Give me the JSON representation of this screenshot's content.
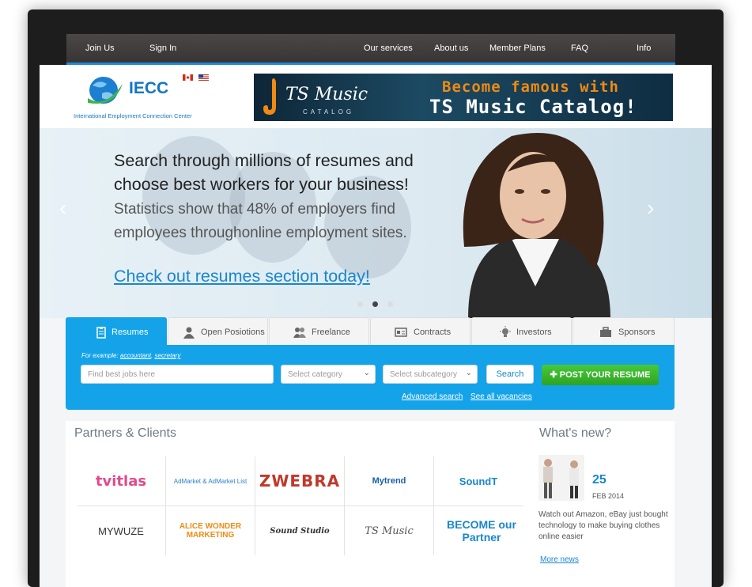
{
  "nav": {
    "join": "Join Us",
    "signin": "Sign In",
    "services": "Our services",
    "about": "About us",
    "plans": "Member Plans",
    "faq": "FAQ",
    "info": "Info"
  },
  "logo": {
    "name": "IECC",
    "subtitle": "International Employment Connection Center"
  },
  "banner": {
    "line1": "Become famous with",
    "line2": "TS Music Catalog!",
    "brand": "TS Music",
    "brand_sub": "CATALOG"
  },
  "hero": {
    "headline_a": "Search through millions of resumes and choose best workers for your business!",
    "headline_b": " Statistics show that 48% of employers find employees throughonline employment sites.",
    "link": "Check out resumes section today!"
  },
  "tabs": [
    "Resumes",
    "Open Posiotions",
    "Freelance",
    "Contracts",
    "Investors",
    "Sponsors"
  ],
  "search": {
    "example_prefix": "For example: ",
    "example_1": "accountant",
    "example_sep": ", ",
    "example_2": "secretary",
    "placeholder": "Find best jobs here",
    "category": "Select category",
    "subcategory": "Select subcategory",
    "search_btn": "Search",
    "post_btn": "POST YOUR RESUME",
    "advanced": "Advanced search",
    "all_vacancies": "See all vacancies"
  },
  "partners": {
    "title": "Partners & Clients",
    "logos": [
      "tvitlas",
      "AdMarket & AdMarket List",
      "ZWEBRA",
      "Mytrend",
      "SoundT",
      "MYWUZE",
      "ALICE WONDER MARKETING",
      "Sound Studio",
      "TS Music",
      "BECOME our Partner"
    ]
  },
  "news": {
    "title": "What's new?",
    "day": "25",
    "month": "FEB 2014",
    "text": "Watch out Amazon, eBay just bought technology to make buying clothes online easier",
    "more": "More news"
  },
  "colors": {
    "accent": "#14a3e8",
    "nav_bg": "#3f3c3b",
    "green": "#37b02a",
    "link": "#1a86cf"
  }
}
